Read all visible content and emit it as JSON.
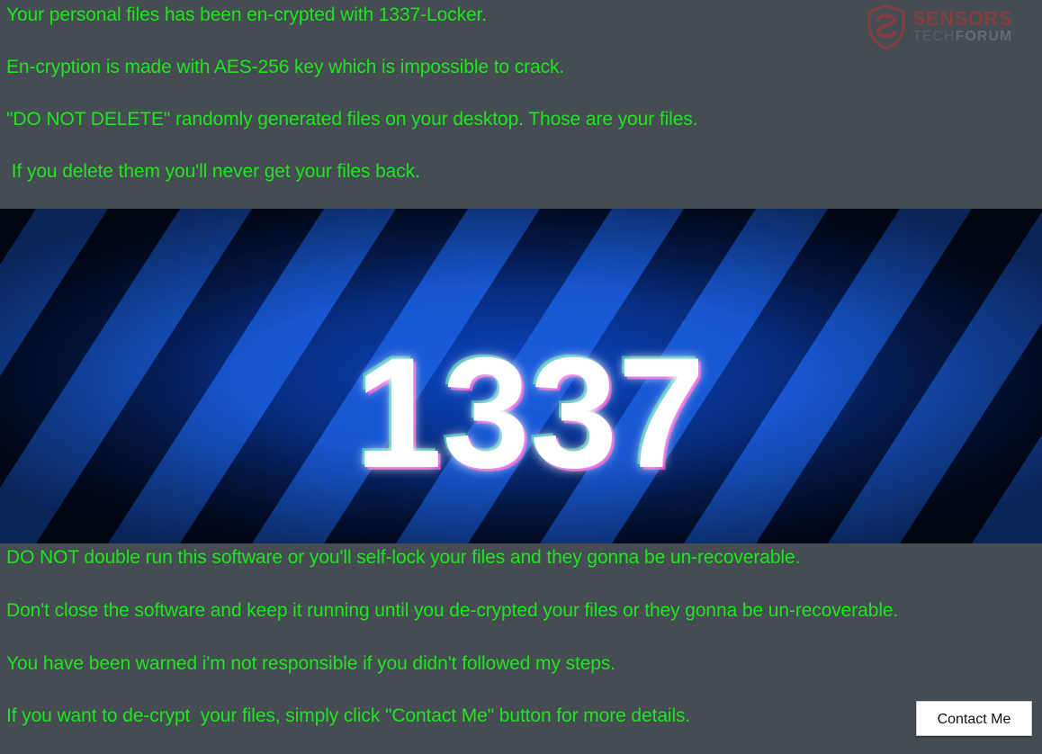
{
  "messages_top": [
    "Your personal files has been en-crypted with 1337-Locker.",
    "En-cryption is made with AES-256 key which is impossible to crack.",
    "\"DO NOT DELETE\" randomly generated files on your desktop. Those are your files.",
    " If you delete them you'll never get your files back."
  ],
  "banner": {
    "logo_text": "1337"
  },
  "messages_bottom": [
    "DO NOT double run this software or you'll self-lock your files and they gonna be un-recoverable.",
    "Don't close the software and keep it running until you de-crypted your files or they gonna be un-recoverable.",
    "You have been warned i'm not responsible if you didn't followed my steps.",
    "If you want to de-crypt  your files, simply click \"Contact Me\" button for more details."
  ],
  "contact_button": {
    "label": "Contact Me"
  },
  "watermark": {
    "line1": "SENSORS",
    "line2_light": "TECH",
    "line2_bold": "FORUM",
    "icon": "shield-icon"
  },
  "colors": {
    "background": "#454c52",
    "text": "#1ee61e",
    "banner_dark": "#03153a",
    "banner_stripe": "#1b5fe0",
    "watermark_red": "#b73436"
  }
}
